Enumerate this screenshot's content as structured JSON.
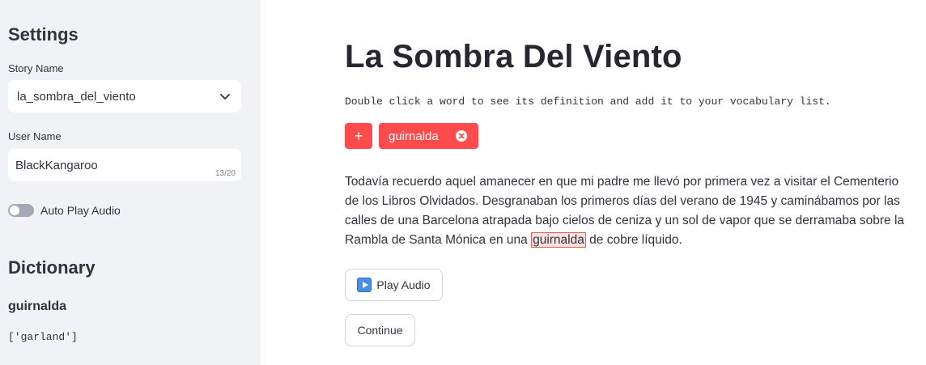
{
  "sidebar": {
    "settings_title": "Settings",
    "story_name": {
      "label": "Story Name",
      "value": "la_sombra_del_viento"
    },
    "user_name": {
      "label": "User Name",
      "value": "BlackKangaroo",
      "counter": "13/20"
    },
    "auto_play": {
      "label": "Auto Play Audio",
      "enabled": false
    },
    "dictionary": {
      "title": "Dictionary",
      "word": "guirnalda",
      "definition": "['garland']"
    }
  },
  "main": {
    "title": "La Sombra Del Viento",
    "hint": "Double click a word to see its definition and add it to your vocabulary list.",
    "add_label": "+",
    "vocab_chip": "guirnalda",
    "story": {
      "before": "Todavía recuerdo aquel amanecer en que mi padre me llevó por primera vez a visitar el Cementerio de los Libros Olvidados. Desgranaban los primeros días del verano de 1945 y caminábamos por las calles de una Barcelona atrapada bajo cielos de ceniza y un sol de vapor que se derramaba sobre la Rambla de Santa Mónica en una ",
      "highlight": "guirnalda",
      "after": " de cobre líquido."
    },
    "play_audio_label": "Play Audio",
    "continue_label": "Continue"
  },
  "colors": {
    "accent": "#ff4b4b",
    "sidebar_bg": "#f0f2f6",
    "highlight_bg": "#fde2e2"
  }
}
